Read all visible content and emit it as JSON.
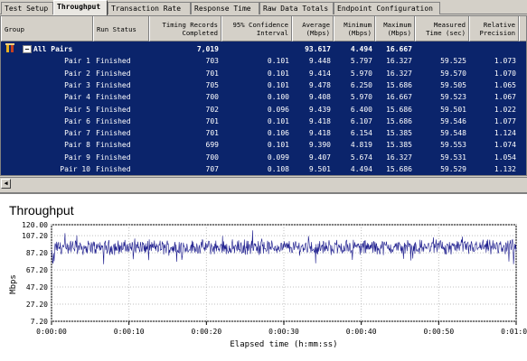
{
  "tabs": [
    "Test Setup",
    "Throughput",
    "Transaction Rate",
    "Response Time",
    "Raw Data Totals",
    "Endpoint Configuration"
  ],
  "table": {
    "headers": {
      "group": "Group",
      "status": "Run Status",
      "records": "Timing Records\nCompleted",
      "confidence": "95% Confidence\nInterval",
      "average": "Average\n(Mbps)",
      "minimum": "Minimum\n(Mbps)",
      "maximum": "Maximum\n(Mbps)",
      "measured": "Measured\nTime (sec)",
      "precision": "Relative\nPrecision"
    },
    "all_pairs": {
      "toggle": "−",
      "name": "All Pairs",
      "records": "7,019",
      "average": "93.617",
      "minimum": "4.494",
      "maximum": "16.667"
    },
    "rows": [
      {
        "name": "Pair 1",
        "status": "Finished",
        "records": "703",
        "confidence": "0.101",
        "average": "9.448",
        "minimum": "5.797",
        "maximum": "16.327",
        "measured": "59.525",
        "precision": "1.073"
      },
      {
        "name": "Pair 2",
        "status": "Finished",
        "records": "701",
        "confidence": "0.101",
        "average": "9.414",
        "minimum": "5.970",
        "maximum": "16.327",
        "measured": "59.570",
        "precision": "1.070"
      },
      {
        "name": "Pair 3",
        "status": "Finished",
        "records": "705",
        "confidence": "0.101",
        "average": "9.478",
        "minimum": "6.250",
        "maximum": "15.686",
        "measured": "59.505",
        "precision": "1.065"
      },
      {
        "name": "Pair 4",
        "status": "Finished",
        "records": "700",
        "confidence": "0.100",
        "average": "9.408",
        "minimum": "5.970",
        "maximum": "16.667",
        "measured": "59.523",
        "precision": "1.067"
      },
      {
        "name": "Pair 5",
        "status": "Finished",
        "records": "702",
        "confidence": "0.096",
        "average": "9.439",
        "minimum": "6.400",
        "maximum": "15.686",
        "measured": "59.501",
        "precision": "1.022"
      },
      {
        "name": "Pair 6",
        "status": "Finished",
        "records": "701",
        "confidence": "0.101",
        "average": "9.418",
        "minimum": "6.107",
        "maximum": "15.686",
        "measured": "59.546",
        "precision": "1.077"
      },
      {
        "name": "Pair 7",
        "status": "Finished",
        "records": "701",
        "confidence": "0.106",
        "average": "9.418",
        "minimum": "6.154",
        "maximum": "15.385",
        "measured": "59.548",
        "precision": "1.124"
      },
      {
        "name": "Pair 8",
        "status": "Finished",
        "records": "699",
        "confidence": "0.101",
        "average": "9.390",
        "minimum": "4.819",
        "maximum": "15.385",
        "measured": "59.553",
        "precision": "1.074"
      },
      {
        "name": "Pair 9",
        "status": "Finished",
        "records": "700",
        "confidence": "0.099",
        "average": "9.407",
        "minimum": "5.674",
        "maximum": "16.327",
        "measured": "59.531",
        "precision": "1.054"
      },
      {
        "name": "Pair 10",
        "status": "Finished",
        "records": "707",
        "confidence": "0.108",
        "average": "9.501",
        "minimum": "4.494",
        "maximum": "15.686",
        "measured": "59.529",
        "precision": "1.132"
      }
    ]
  },
  "chart_data": {
    "type": "line",
    "title": "Throughput",
    "xlabel": "Elapsed time (h:mm:ss)",
    "ylabel": "Mbps",
    "yticks": [
      "120.00",
      "107.20",
      "87.20",
      "67.20",
      "47.20",
      "27.20",
      "7.20"
    ],
    "ytick_values": [
      120.0,
      107.2,
      87.2,
      67.2,
      47.2,
      27.2,
      7.2
    ],
    "xticks": [
      "0:00:00",
      "0:00:10",
      "0:00:20",
      "0:00:30",
      "0:00:40",
      "0:00:50",
      "0:01:00"
    ],
    "xtick_values": [
      0,
      10,
      20,
      30,
      40,
      50,
      60
    ],
    "ylim": [
      7.2,
      120.0
    ],
    "xlim": [
      0,
      60
    ],
    "grid": true,
    "series": [
      {
        "color": "#1a1a8c",
        "mean": 93.617,
        "min_observed": 70.0,
        "max_observed": 114.0,
        "sample_count": 7019
      }
    ]
  },
  "colors": {
    "table_bg": "#0b246b",
    "series_line": "#1a1a8c"
  }
}
